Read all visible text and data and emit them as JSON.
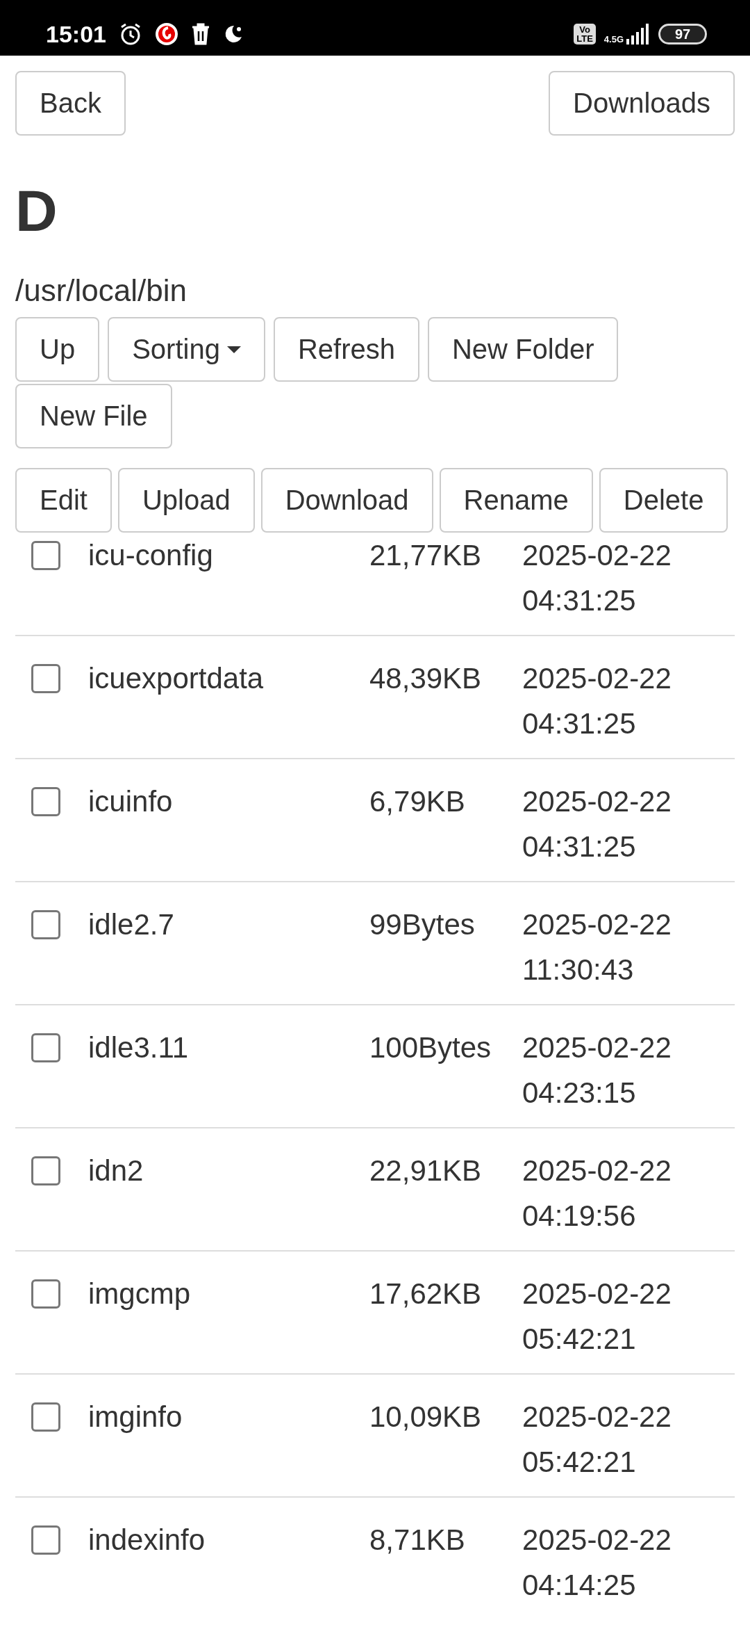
{
  "status_bar": {
    "time": "15:01",
    "volte_top": "Vo",
    "volte_bottom": "LTE",
    "network": "4.5G",
    "battery": "97"
  },
  "nav": {
    "back": "Back",
    "downloads": "Downloads"
  },
  "title": "D",
  "path": "/usr/local/bin",
  "toolbar": [
    {
      "label": "Up",
      "kind": "plain"
    },
    {
      "label": "Sorting",
      "kind": "dropdown"
    },
    {
      "label": "Refresh",
      "kind": "plain"
    },
    {
      "label": "New Folder",
      "kind": "plain"
    },
    {
      "label": "New File",
      "kind": "plain"
    }
  ],
  "actions": [
    "Edit",
    "Upload",
    "Download",
    "Rename",
    "Delete"
  ],
  "files": [
    {
      "name": "icu-config",
      "size": "21,77KB",
      "date": "2025-02-22",
      "time": "04:31:25",
      "checked": false
    },
    {
      "name": "icuexportdata",
      "size": "48,39KB",
      "date": "2025-02-22",
      "time": "04:31:25",
      "checked": false
    },
    {
      "name": "icuinfo",
      "size": "6,79KB",
      "date": "2025-02-22",
      "time": "04:31:25",
      "checked": false
    },
    {
      "name": "idle2.7",
      "size": "99Bytes",
      "date": "2025-02-22",
      "time": "11:30:43",
      "checked": false
    },
    {
      "name": "idle3.11",
      "size": "100Bytes",
      "date": "2025-02-22",
      "time": "04:23:15",
      "checked": false
    },
    {
      "name": "idn2",
      "size": "22,91KB",
      "date": "2025-02-22",
      "time": "04:19:56",
      "checked": false
    },
    {
      "name": "imgcmp",
      "size": "17,62KB",
      "date": "2025-02-22",
      "time": "05:42:21",
      "checked": false
    },
    {
      "name": "imginfo",
      "size": "10,09KB",
      "date": "2025-02-22",
      "time": "05:42:21",
      "checked": false
    },
    {
      "name": "indexinfo",
      "size": "8,71KB",
      "date": "2025-02-22",
      "time": "04:14:25",
      "checked": false
    }
  ]
}
